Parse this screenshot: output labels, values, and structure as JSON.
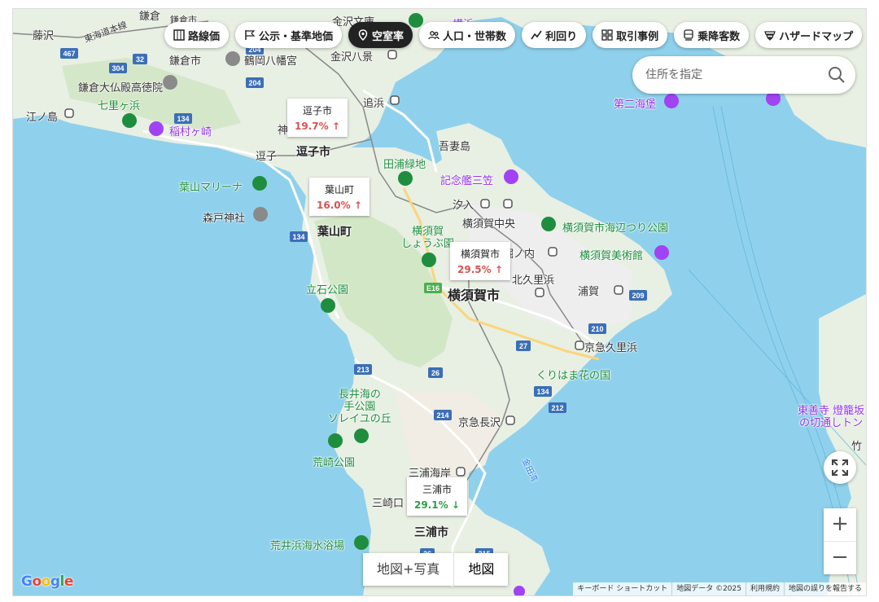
{
  "layers": [
    {
      "id": "rosen",
      "label": "路線価",
      "icon": "grid-icon",
      "active": false
    },
    {
      "id": "koji",
      "label": "公示・基準地価",
      "icon": "flag-icon",
      "active": false
    },
    {
      "id": "vacancy",
      "label": "空室率",
      "icon": "pin-icon",
      "active": true
    },
    {
      "id": "population",
      "label": "人口・世帯数",
      "icon": "people-icon",
      "active": false
    },
    {
      "id": "yield",
      "label": "利回り",
      "icon": "trend-icon",
      "active": false
    },
    {
      "id": "trades",
      "label": "取引事例",
      "icon": "building-icon",
      "active": false
    },
    {
      "id": "passengers",
      "label": "乗降客数",
      "icon": "train-icon",
      "active": false
    },
    {
      "id": "hazard",
      "label": "ハザードマップ",
      "icon": "shield-icon",
      "active": false
    }
  ],
  "search": {
    "placeholder": "住所を指定"
  },
  "vacancy_labels": [
    {
      "name": "逗子市",
      "rate": "19.7%",
      "arrow": "↑",
      "trend": "up"
    },
    {
      "name": "葉山町",
      "rate": "16.0%",
      "arrow": "↑",
      "trend": "up"
    },
    {
      "name": "横須賀市",
      "rate": "29.5%",
      "arrow": "↑",
      "trend": "up"
    },
    {
      "name": "三浦市",
      "rate": "29.1%",
      "arrow": "↓",
      "trend": "down"
    }
  ],
  "places": {
    "kamakura_top": "鎌倉",
    "kamakura_ichi": "鎌倉市",
    "kamakura_station": "鎌倉市",
    "fujisawa": "藤沢",
    "tokaido": "東海道本線",
    "kanazawa_bunko": "金沢文庫",
    "yokohama_top": "横浜",
    "tsurugaoka": "鶴岡八幡宮",
    "kanazawa_hakkei": "金沢八景",
    "daibutsu": "鎌倉大仏殿高徳院",
    "shichirigahama": "七里ヶ浜",
    "enoshima": "江ノ島",
    "inamuragasaki": "稲村ヶ崎",
    "oppama": "追浜",
    "zushi": "逗子",
    "zushi_city": "逗子市",
    "jin": "神",
    "azumajima": "吾妻島",
    "taura": "田浦緑地",
    "mikasa": "記念艦三笠",
    "hayama_marina": "葉山マリーナ",
    "shiomi": "汐入",
    "yokosuka_chuo": "横須賀中央",
    "umibe_park": "横須賀市海辺つり公園",
    "morito": "森戸神社",
    "hayama": "葉山町",
    "shobu": "横須賀\nしょうぶ園",
    "horinouchi": "堀ノ内",
    "yokosuka_museum": "横須賀美術館",
    "daini_kaiho": "第二海堡",
    "kitakurihama": "北久里浜",
    "uraga": "浦賀",
    "tateishi": "立石公園",
    "yokosuka_city": "横須賀市",
    "keikyu_kurihama": "京急久里浜",
    "kurihama_hana": "くりはま花の国",
    "nagai": "長井海の\n手公園\nソレイユの丘",
    "keikyu_nagasawa": "京急長沢",
    "arasaki": "荒崎公園",
    "tokeiji": "東善寺 燈籠坂\nの切通しトン",
    "miura_kaigan": "三浦海岸",
    "misakiguchi": "三崎口",
    "kanedawan": "金田湾",
    "miura_city": "三浦市",
    "arai_beach": "荒井浜海水浴場",
    "futtsu": "竹"
  },
  "roads": [
    "467",
    "304",
    "32",
    "204",
    "204",
    "134",
    "134",
    "E16",
    "209",
    "210",
    "27",
    "213",
    "26",
    "214",
    "134",
    "212",
    "26",
    "215"
  ],
  "map_type": [
    "地図+写真",
    "地図"
  ],
  "zoom": {
    "in": "+",
    "out": "−"
  },
  "attribution": [
    "キーボード ショートカット",
    "地図データ ©2025",
    "利用規約",
    "地図の誤りを報告する"
  ],
  "logo": "Google",
  "colors": {
    "sea": "#8fd1ec",
    "land": "#e8efe3",
    "forest": "#cfe5c2",
    "urban": "#efefef",
    "road": "#ffffff",
    "highway": "#fbd57a",
    "active": "#222222",
    "up": "#d9534f",
    "down": "#2e9e44"
  }
}
